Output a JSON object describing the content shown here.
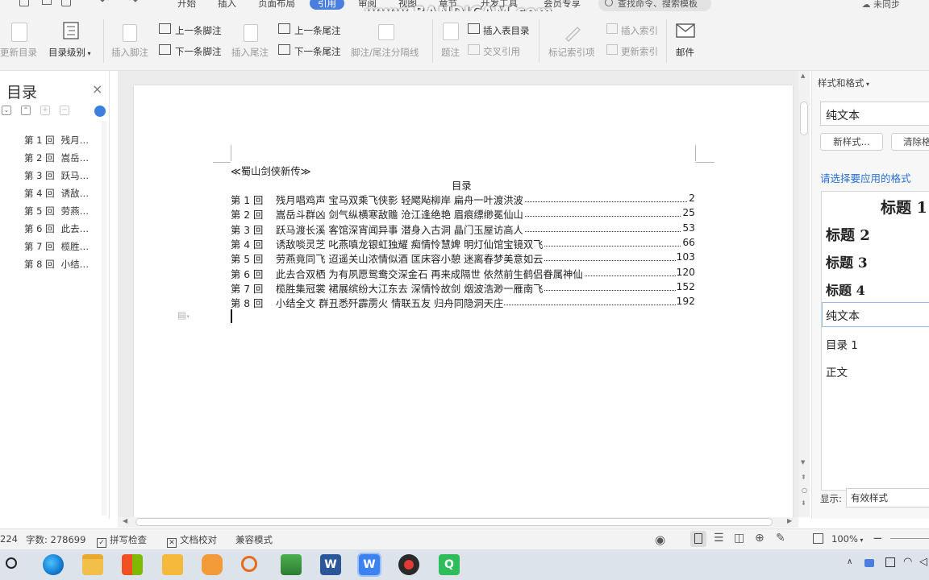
{
  "menu": {
    "tabs": [
      "开始",
      "插入",
      "页面布局",
      "引用",
      "审阅",
      "视图",
      "章节",
      "开发工具",
      "会员专享"
    ],
    "active_tab": "引用",
    "search_placeholder": "查找命令、搜索模板",
    "sync_label": "未同步"
  },
  "watermark": "www.BANDICAM.com",
  "ribbon": {
    "update_toc": "更新目录",
    "toc_level": "目录级别",
    "insert_footnote": "插入脚注",
    "prev_footnote": "上一条脚注",
    "next_footnote": "下一条脚注",
    "insert_endnote": "插入尾注",
    "prev_endnote": "上一条尾注",
    "next_endnote": "下一条尾注",
    "note_separator": "脚注/尾注分隔线",
    "caption": "题注",
    "insert_table_of_figures": "插入表目录",
    "cross_reference": "交叉引用",
    "mark_entry": "标记索引项",
    "insert_index": "插入索引",
    "update_index": "更新索引",
    "mail": "邮件"
  },
  "navpane": {
    "title": "目录",
    "items": [
      {
        "num": "第 1 回",
        "text": "残月…"
      },
      {
        "num": "第 2 回",
        "text": "嵩岳…"
      },
      {
        "num": "第 3 回",
        "text": "跃马…"
      },
      {
        "num": "第 4 回",
        "text": "诱敌…"
      },
      {
        "num": "第 5 回",
        "text": "劳燕…"
      },
      {
        "num": "第 6 回",
        "text": "此去…"
      },
      {
        "num": "第 7 回",
        "text": "榄胜…"
      },
      {
        "num": "第 8 回",
        "text": "小结…"
      }
    ]
  },
  "document": {
    "book_title": "≪蜀山剑侠新传≫",
    "toc_heading": "目录",
    "toc": [
      {
        "num": "第 1 回",
        "title": "残月唱鸡声  宝马双乘飞侠影  轻飔飐柳岸  扁舟一叶渡洪波",
        "page": "2"
      },
      {
        "num": "第 2 回",
        "title": "嵩岳斗群凶  剑气纵横寒敌赡  沧江逢绝艳  眉痕缥缈冕仙山",
        "page": "25"
      },
      {
        "num": "第 3 回",
        "title": "跃马渡长溪  客馆深宵闻异事  潜身入古洞  晶门玉屋访高人",
        "page": "53"
      },
      {
        "num": "第 4 回",
        "title": "诱敌啖灵芝  叱燕嗔龙银虹独耀  痴情怜慧婢  明灯仙馆宝镜双飞",
        "page": "66"
      },
      {
        "num": "第 5 回",
        "title": "劳燕竟同飞  迢遥关山浓情似酒  匡床容小憩  迷离春梦美意如云",
        "page": "103"
      },
      {
        "num": "第 6 回",
        "title": "此去合双栖  为有夙愿鸳鸯交深金石  再来成隔世  依然前生鹤侣眷属神仙",
        "page": "120"
      },
      {
        "num": "第 7 回",
        "title": "榄胜集冠裳  裙展缤纷大江东去  深情怜故剑  烟波浩渺一雁南飞",
        "page": "152"
      },
      {
        "num": "第 8 回",
        "title": "小结全文  群丑悉歼霹雳火  情联五友  归舟同隐洞天庄",
        "page": "192"
      }
    ]
  },
  "stylespane": {
    "title": "样式和格式",
    "current_style": "纯文本",
    "new_style": "新样式...",
    "clear": "清除格",
    "prompt": "请选择要应用的格式",
    "styles": [
      {
        "label": "标题 1"
      },
      {
        "label": "标题 2"
      },
      {
        "label": "标题 3"
      },
      {
        "label": "标题 4"
      },
      {
        "label": "纯文本"
      },
      {
        "label": "目录 1"
      },
      {
        "label": "正文"
      }
    ],
    "show_label": "显示:",
    "show_value": "有效样式"
  },
  "status": {
    "page_fragment": "224",
    "word_count": "字数: 278699",
    "spell_check": "拼写检查",
    "doc_proof": "文档校对",
    "compat_mode": "兼容模式",
    "zoom": "100%"
  },
  "colors": {
    "accent": "#4a7fe0",
    "link_blue": "#2a6fd6",
    "ribbon_bg": "#f3f3f3",
    "taskbar_bg": "#dde3ea"
  }
}
